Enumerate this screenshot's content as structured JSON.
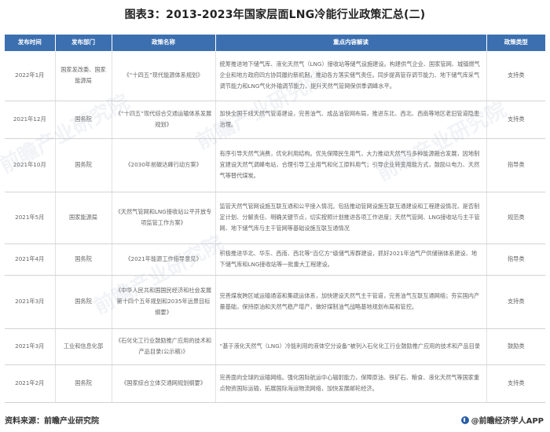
{
  "title": "图表3：2013-2023年国家层面LNG冷能行业政策汇总(二)",
  "table": {
    "headers": [
      "发布时间",
      "发布部门",
      "政策名称",
      "重点内容解读",
      "政策类型"
    ],
    "rows": [
      {
        "date": "2022年1月",
        "dept": "国家发改委、国家能源局",
        "name": "《“十四五”现代能源体系规划》",
        "content": "统筹推进地下储气库、液化天然气（LNG）接收站等储气设施建设。构建供气企业、国家管网、城镇燃气企业和地方政府四方协同履约新机制，推动各方落实储气责任。同步提高管存调节能力、地下储气库采气调节能力和LNG气化外输调节能力，提升天然气管网保供季调峰水平。",
        "type": "支持类"
      },
      {
        "date": "2021年12月",
        "dept": "国务院",
        "name": "《“十四五”现代综合交通运输体系发展规划》",
        "content": "加快全国干线天然气管道建设，完善油气、成品油管网布局，推进东北、西北、西南等地区老旧管道隐患治理。",
        "type": "支持类"
      },
      {
        "date": "2021年10月",
        "dept": "国务院",
        "name": "《2030年前碳达峰行动方案》",
        "content": "有序引导天然气消费，优化利用结构。优先保障民生用气，大力推动天然气与多种能源融合发展，因地制宜建设天然气调峰电站，合理引导工业用气和化工原料用气；引导企业转变用能方式，鼓励以电力、天然气等替代煤炭。",
        "type": "指导类"
      },
      {
        "date": "2021年5月",
        "dept": "国家能源局",
        "name": "《天然气管网和LNG接收站公平开放专项监管工作方案》",
        "content": "监管天然气管网设施互联互通和公平接入情况。包括推动管网设施互联互通建设和工程建设情况，是否制定计划、分解责任、明确关键节点，切实按照计划推进各项工作进度；天然气管网、LNG接收站与主干管网、地下储气库与主干管网等基础设施互联互通情况",
        "type": "规范类"
      },
      {
        "date": "2021年4月",
        "dept": "国务院",
        "name": "《2021年能源工作指导意见》",
        "content": "积极推进华北、华东、西南、西北等“百亿方”级储气库群建设，抓好2021年油气产供储销体系建设、地下储气库和LNG接收站等一批重大工程建设。",
        "type": "指导类"
      },
      {
        "date": "2021年3月",
        "dept": "国务院",
        "name": "《中华人民共和国国民经济和社会发展第十四个五年规划和2035年远景目标纲要》",
        "content": "完善煤炭跨区域运输通道和集疏运体系，加快建设天然气主干管道，完善油气互联互通网络；夯实国内产量基础，保持原油和天然气稳产增产，做好煤制油气战略基地规划布局和管控。",
        "type": "支持类"
      },
      {
        "date": "2021年3月",
        "dept": "工业和信息化部",
        "name": "《石化化工行业鼓励推广应用的技术和产品目录(公示稿)》",
        "content": "“基于液化天然气（LNG）冷能利用的液体空分设备”被列入石化化工行业鼓励推广应用的技术和产品目录",
        "type": "鼓励类"
      },
      {
        "date": "2021年2月",
        "dept": "国务院",
        "name": "《国家综合立体交通网规划纲要》",
        "content": "完善面向全球的运输网络。强化国际航运中心辐射能力，保障原油、铁矿石、粮食、液化天然气等国家重点物资国际运输，拓展国际海运物流网络，加快发展邮轮经济。",
        "type": "支持类"
      }
    ]
  },
  "watermarks": [
    "前瞻产业研究院",
    "前瞻产业研究院",
    "前瞻产业研究院",
    "前瞻产业研究院"
  ],
  "footer": {
    "source": "资料来源：前瞻产业研究院",
    "brand": "@前瞻经济学人APP",
    "brand_icon": "qianzhan-logo-icon"
  }
}
